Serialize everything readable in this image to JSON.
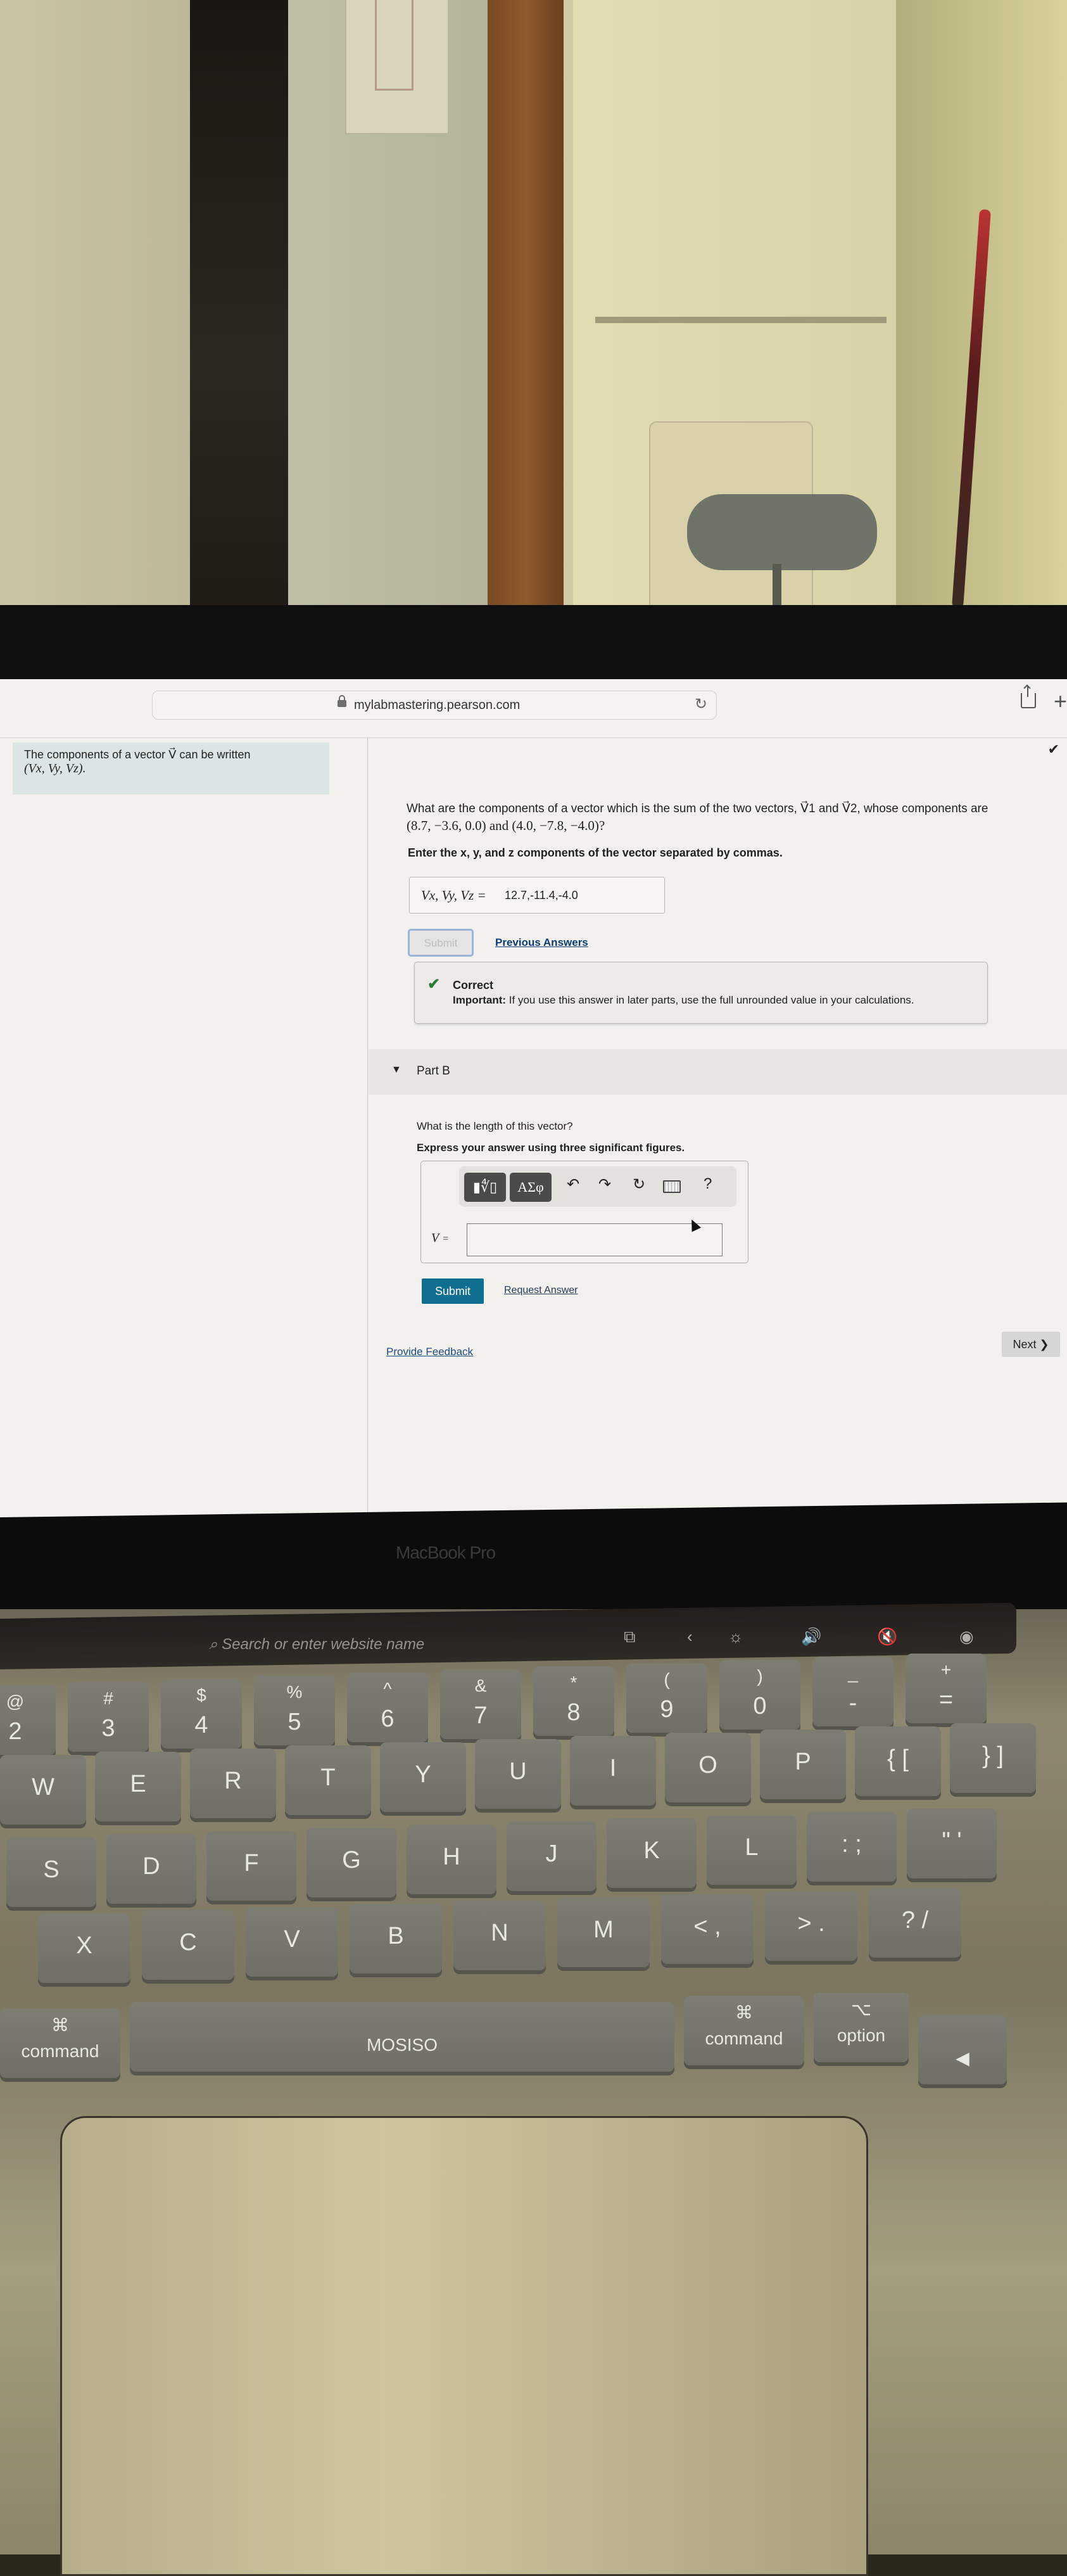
{
  "browser": {
    "url": "mylabmastering.pearson.com",
    "icons": {
      "lock": "lock-icon",
      "reload": "reload-icon",
      "share": "share-icon",
      "new_tab": "plus-icon"
    },
    "reload_glyph": "↻",
    "new_tab_glyph": "+"
  },
  "sidebar": {
    "intro_text": "The components of a vector V⃗ can be written",
    "intro_math": "(Vx, Vy, Vz)."
  },
  "part_a": {
    "completed_check": "✔",
    "question_text": "What are the components of a vector which is the sum of the two vectors, V⃗1 and V⃗2, whose components are",
    "question_math": "(8.7, −3.6, 0.0) and (4.0, −7.8, −4.0)?",
    "instruction": "Enter the x, y, and z components of the vector separated by commas.",
    "answer_label": "Vx, Vy, Vz =",
    "answer_value": "12.7,-11.4,-4.0",
    "submit_label": "Submit",
    "previous_answers_label": "Previous Answers",
    "feedback": {
      "status": "Correct",
      "icon": "✔",
      "important_label": "Important:",
      "message": " If you use this answer in later parts, use the full unrounded value in your calculations."
    }
  },
  "part_b": {
    "expand_icon": "▼",
    "title": "Part B",
    "question": "What is the length of this vector?",
    "instruction": "Express your answer using three significant figures.",
    "toolbar": {
      "templates_glyph": "▮∜▯",
      "greek_label": "ΑΣφ",
      "undo_glyph": "↶",
      "redo_glyph": "↷",
      "reset_glyph": "↻",
      "help_glyph": "?"
    },
    "answer_label": "V",
    "equals": "=",
    "answer_value": "",
    "submit_label": "Submit",
    "request_answer_label": "Request Answer"
  },
  "footer": {
    "provide_feedback_label": "Provide Feedback",
    "next_label": "Next ❯"
  },
  "laptop": {
    "brand": "MacBook Pro",
    "touchbar": {
      "search_placeholder": "Search or enter website name",
      "icons": [
        "new-tab-icon",
        "back-icon",
        "brightness-icon",
        "volume-icon",
        "mute-icon",
        "siri-icon"
      ],
      "glyphs": [
        "⧉",
        "‹",
        "☼",
        "🔊",
        "🔇",
        "◉"
      ]
    },
    "keyboard": {
      "number_row": [
        {
          "top": "@",
          "bot": "2"
        },
        {
          "top": "#",
          "bot": "3"
        },
        {
          "top": "$",
          "bot": "4"
        },
        {
          "top": "%",
          "bot": "5"
        },
        {
          "top": "^",
          "bot": "6"
        },
        {
          "top": "&",
          "bot": "7"
        },
        {
          "top": "*",
          "bot": "8"
        },
        {
          "top": "(",
          "bot": "9"
        },
        {
          "top": ")",
          "bot": "0"
        },
        {
          "top": "_",
          "bot": "-"
        },
        {
          "top": "+",
          "bot": "="
        }
      ],
      "qwerty_row": [
        "W",
        "E",
        "R",
        "T",
        "Y",
        "U",
        "I",
        "O",
        "P",
        "{ [",
        "} ]"
      ],
      "home_row": [
        "S",
        "D",
        "F",
        "G",
        "H",
        "J",
        "K",
        "L",
        ": ;",
        "\" '"
      ],
      "bottom_row": [
        "X",
        "C",
        "V",
        "B",
        "N",
        "M",
        "< ,",
        "> .",
        "? /"
      ],
      "space_row": {
        "left_command": "command",
        "left_command_glyph": "⌘",
        "space_brand": "MOSISO",
        "right_command": "command",
        "right_command_glyph": "⌘",
        "option": "option",
        "option_glyph": "⌥",
        "arrow_left": "◀"
      }
    }
  }
}
